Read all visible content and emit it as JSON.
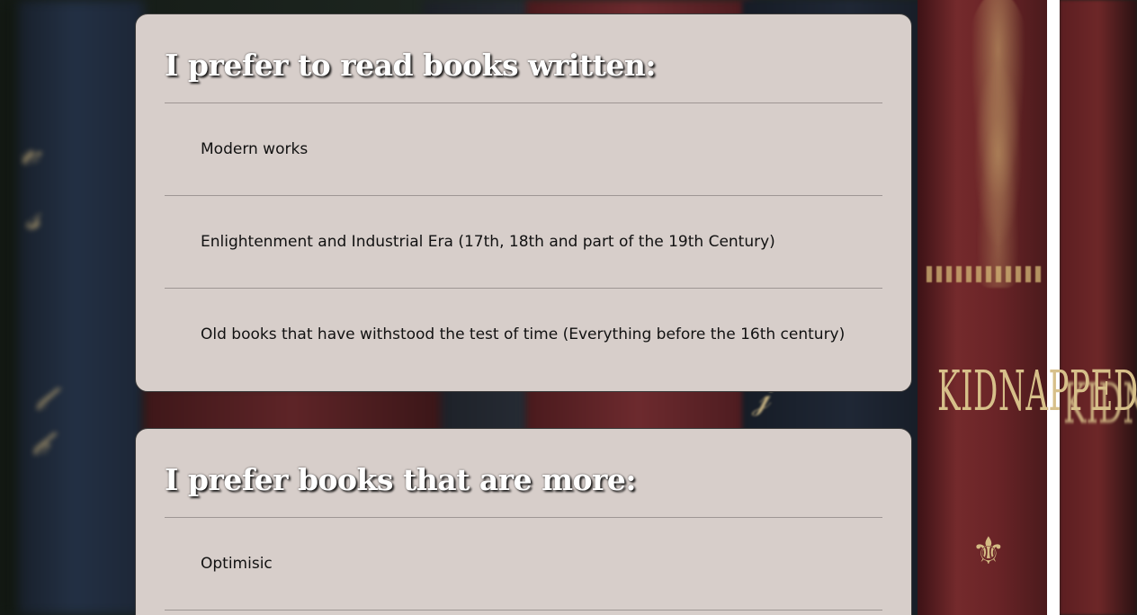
{
  "background": {
    "spine_texts": [
      "KIDNAPPED"
    ],
    "colors": {
      "card_background": "#d7ceca",
      "title_text": "#ffffff",
      "option_text": "#111111",
      "divider": "#9e9694"
    }
  },
  "questions": [
    {
      "title": "I prefer to read books written:",
      "options": [
        "Modern works",
        "Enlightenment and Industrial Era (17th, 18th and part of the 19th Century)",
        "Old books that have withstood the test of time (Everything before the 16th century)"
      ]
    },
    {
      "title": "I prefer books that are more:",
      "options": [
        "Optimisic"
      ]
    }
  ]
}
